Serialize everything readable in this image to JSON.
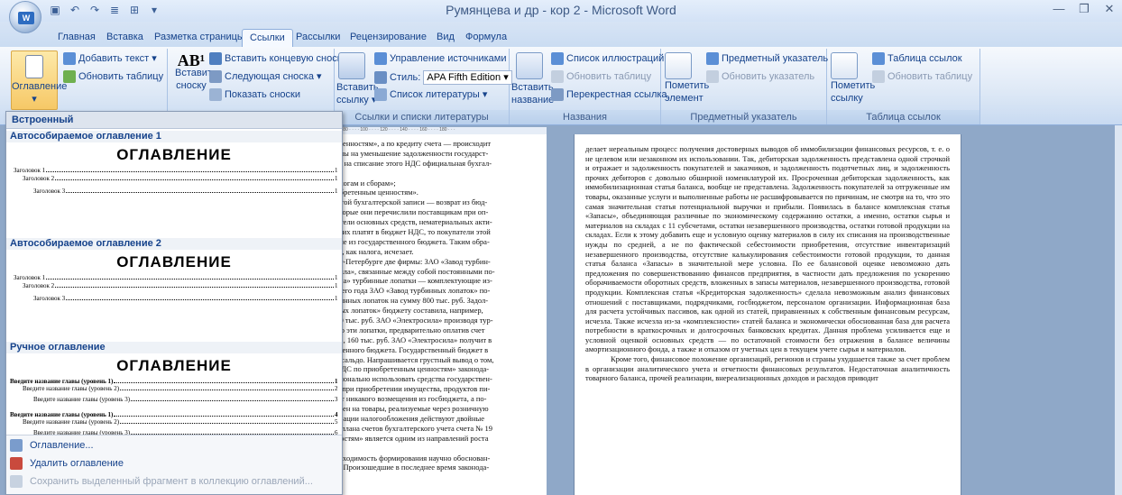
{
  "window": {
    "title": "Румянцева и др - кор 2 - Microsoft Word"
  },
  "tabs": [
    "Главная",
    "Вставка",
    "Разметка страницы",
    "Ссылки",
    "Рассылки",
    "Рецензирование",
    "Вид",
    "Формула"
  ],
  "ribbon": {
    "toc_button": "Оглавление",
    "add_text": "Добавить текст",
    "update_table": "Обновить таблицу",
    "insert_footnote_line1": "Вставить",
    "insert_footnote_line2": "сноску",
    "insert_endnote": "Вставить концевую сноску",
    "next_footnote": "Следующая сноска",
    "show_notes": "Показать сноски",
    "insert_citation_line1": "Вставить",
    "insert_citation_line2": "ссылку",
    "manage_sources": "Управление источниками",
    "style_label": "Стиль:",
    "style_value": "APA Fifth Edition",
    "bibliography": "Список литературы",
    "group_citations": "Ссылки и списки литературы",
    "insert_caption_line1": "Вставить",
    "insert_caption_line2": "название",
    "table_of_figures": "Список иллюстраций",
    "update_table2": "Обновить таблицу",
    "cross_reference": "Перекрестная ссылка",
    "group_captions": "Названия",
    "mark_entry_line1": "Пометить",
    "mark_entry_line2": "элемент",
    "insert_index": "Предметный указатель",
    "update_index": "Обновить указатель",
    "group_index": "Предметный указатель",
    "mark_citation_line1": "Пометить",
    "mark_citation_line2": "ссылку",
    "table_of_authorities": "Таблица ссылок",
    "update_table3": "Обновить таблицу",
    "group_authorities": "Таблица ссылок"
  },
  "dropdown": {
    "header": "Встроенный",
    "auto1_label": "Автособираемое оглавление 1",
    "auto1_title": "ОГЛАВЛЕНИЕ",
    "auto2_label": "Автособираемое оглавление 2",
    "auto2_title": "ОГЛАВЛЕНИЕ",
    "manual_label": "Ручное оглавление",
    "manual_title": "ОГЛАВЛЕНИЕ",
    "h1": "Заголовок 1",
    "h2": "Заголовок 2",
    "h3": "Заголовок 3",
    "p1": "1",
    "m1": "Введите название главы (уровень 1)",
    "m2": "Введите название главы (уровень 2)",
    "m3": "Введите название главы (уровень 3)",
    "mp1": "1",
    "mp2": "2",
    "mp3": "3",
    "mp4": "4",
    "mp5": "5",
    "mp6": "6",
    "cmd_toc": "Оглавление...",
    "cmd_remove": "Удалить оглавление",
    "cmd_save": "Сохранить выделенный фрагмент в коллекцию оглавлений..."
  },
  "ruler_text": "· · · · 80 · · · · 100 · · · · 120 · · · · 140 · · · · 160 · · · · 180 · · ·",
  "left_page_lines": [
    "м ценностям», а по кредиту счета — происходит",
    "сумы на уменьшение задолженности государст-",
    "тся на списание этого НДС официальная бухгал-",
    "",
    "налогам и сборам»;",
    "иобретенным ценностям».",
    "ь этой бухгалтерской записи — возврат из бюд-",
    "которые они перечислили поставщикам при оп-",
    "дители основных средств, нематериальных акти-",
    "же их платят в бюджет НДС, то покупатели этой",
    "ение из государственного бюджета. Таким обра-",
    "ДС, как налога, исчезает.",
    "икт-Петербурге две фирмы: ЗАО «Завод турбин-",
    "осила», связанные между собой постоянными по-",
    "сила» турбинные лопатки — комплектующие из-",
    "ущего года ЗАО «Завод турбинных лопаток» по-",
    "рбинных лопаток на сумму 800 тыс. руб. Задол-",
    "иных лопаток» бюджету составила, например,",
    "160 тыс. руб. ЗАО «Электросила» производя тур-",
    "тью эти лопатки, предварительно оплатив счет",
    "ок», 160 тыс. руб. ЗАО «Электросила» получит в",
    "ственного бюджета. Государственный бюджет в",
    "ое сальдо. Напрашивается грустный вывод о том,",
    "«НДС по приобретенным ценностям» законода-",
    "ационально использовать средства государствен-",
    "ии при приобретении имущества, продуктов пи-",
    "ают никакого возмещения из госбюджета, а по-",
    "м цен на товары, реализуемые через розничную",
    "низации налогообложения действуют двойные",
    "из плана счетов бухгалтерского учета счета № 19",
    "нностям» является одним из направлений роста",
    "",
    "еобходимость формирования научно обоснован-",
    "ти. Произошедшие в последнее время законода-"
  ],
  "right_page_text": "делает нереальным процесс получения достоверных выводов об иммобилизации финансовых ресурсов, т. е. о не целевом или незаконном их использовании. Так, дебиторская задолженность представлена одной строчкой и отражает и задолженность покупателей и заказчиков, и задолженность подотчетных лиц, и задолженность прочих дебиторов с довольно обширной номенклатурой их. Просроченная дебиторская задолженность, как иммобилизационная статья баланса, вообще не представлена. Задолженность покупателей за отгруженные им товары, оказанные услуги и выполненные работы не расшифровывается по причинам, не смотря на то, что это самая значительная статья потенциальной выручки и прибыли. Появилась в балансе комплексная статья «Запасы», объединяющая различные по экономическому содержанию остатки, а именно, остатки сырья и материалов на складах с 11 субсчетами, остатки незавершенного производства, остатки готовой продукции на складах. Если к этому добавить еще и условную оценку материалов в силу их списания на производственные нужды по средней, а не по фактической себестоимости приобретения, отсутствие инвентаризаций незавершенного производства, отсутствие калькулирования себестоимости готовой продукции, то данная статья баланса «Запасы» в значительной мере условна. По ее балансовой оценке невозможно дать предложения по совершенствованию финансов предприятия, в частности дать предложения по ускорению оборачиваемости оборотных средств, вложенных в запасы материалов, незавершенного производства, готовой продукции. Комплексная статья «Кредиторская задолженность» сделала невозможным анализ финансовых отношений с поставщиками, подрядчиками, госбюджетом, персоналом организации. Информационная база для расчета устойчивых пассивов, как одной из статей, приравненных к собственным финансовым ресурсам, исчезла. Также исчезла из-за «комплексности» статей баланса и экономически обоснованная база для расчета потребности в краткосрочных и долгосрочных банковских кредитах. Данная проблема усиливается еще и условной оценкой основных средств — по остаточной стоимости без отражения в балансе величины амортизационного фонда, а также и отказом от учетных цен в текущем учете сырья и материалов.",
  "right_page_text2": "Кроме того, финансовое положение организаций, регионов и страны ухудшается также за счет проблем в организации аналитического учета и отчетности финансовых результатов. Недостаточная аналитичность товарного баланса, прочей реализации, внереализационных доходов и расходов приводит"
}
